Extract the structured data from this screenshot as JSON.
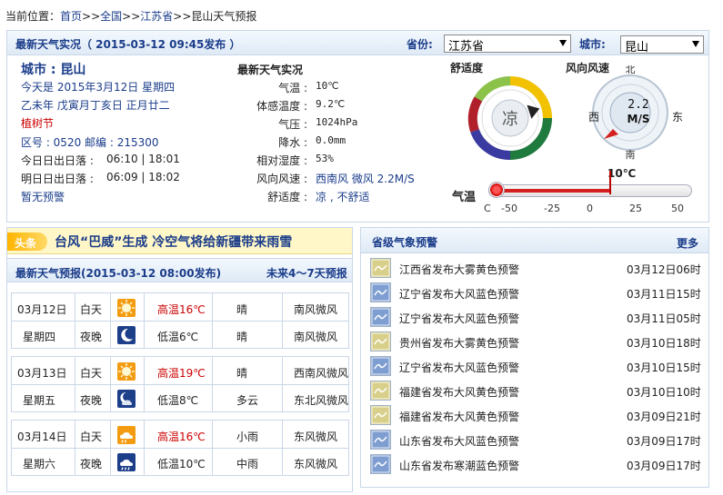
{
  "breadcrumb": {
    "prefix": "当前位置：",
    "items": [
      "首页",
      "全国",
      "江苏省",
      "昆山天气预报"
    ],
    "seps": [
      ">>",
      ">>",
      ">>"
    ]
  },
  "live": {
    "title": "最新天气实况（ 2015-03-12  09:45发布 ）",
    "province_label": "省份:",
    "province_value": "江苏省",
    "city_label": "城市:",
    "city_value": "昆山",
    "city_heading": "城市 : 昆山",
    "today": "今天是  2015年3月12日  星期四",
    "lunar": "乙未年  戊寅月丁亥日  正月廿二",
    "festival": "植树节",
    "codes": "区号 : 0520    邮编 : 215300",
    "sunrise_today_label": "今日日出日落 :",
    "sunrise_today_value": "06:10 | 18:01",
    "sunrise_tomorrow_label": "明日日出日落 :",
    "sunrise_tomorrow_value": "06:09 | 18:02",
    "no_warning": "暂无预警",
    "obs_title": "最新天气实况",
    "obs": [
      {
        "label": "气温 :",
        "value": "10℃"
      },
      {
        "label": "体感温度 :",
        "value": "9.2℃"
      },
      {
        "label": "气压 :",
        "value": "1024hPa"
      },
      {
        "label": "降水 :",
        "value": "0.0mm"
      },
      {
        "label": "相对湿度 :",
        "value": "53%"
      },
      {
        "label": "风向风速 :",
        "value": "西南风 微风 2.2M/S"
      },
      {
        "label": "舒适度 :",
        "value": "凉 , 不舒适"
      }
    ],
    "comfort_title": "舒适度",
    "comfort_value": "凉",
    "wind_title": "风向风速",
    "wind_speed": "2.2",
    "wind_unit": "M/S",
    "dir_n": "北",
    "dir_s": "南",
    "dir_w": "西",
    "dir_e": "东",
    "temp_title": "气温",
    "temp_value_label": "10℃",
    "temp_value": 10,
    "temp_scale": {
      "min": -50,
      "max": 50
    },
    "temp_ticks": [
      "C",
      "-50",
      "-25",
      "0",
      "25",
      "50"
    ]
  },
  "headline": {
    "tag": "头条",
    "text": "台风“巴威”生成 冷空气将给新疆带来雨雪"
  },
  "forecast": {
    "title": "最新天气预报(2015-03-12  08:00发布)",
    "link": "未来4～7天预报",
    "days": [
      {
        "date": "03月12日",
        "week": "星期四",
        "day": {
          "period": "白天",
          "icon": "sunny-icon",
          "temp": "高温16℃",
          "weather": "晴",
          "wind": "南风微风"
        },
        "night": {
          "period": "夜晚",
          "icon": "moon-icon",
          "temp": "低温6℃",
          "weather": "晴",
          "wind": "南风微风"
        }
      },
      {
        "date": "03月13日",
        "week": "星期五",
        "day": {
          "period": "白天",
          "icon": "sunny-icon",
          "temp": "高温19℃",
          "weather": "晴",
          "wind": "西南风微风"
        },
        "night": {
          "period": "夜晚",
          "icon": "cloudy-night-icon",
          "temp": "低温8℃",
          "weather": "多云",
          "wind": "东北风微风"
        }
      },
      {
        "date": "03月14日",
        "week": "星期六",
        "day": {
          "period": "白天",
          "icon": "light-rain-icon",
          "temp": "高温16℃",
          "weather": "小雨",
          "wind": "东风微风"
        },
        "night": {
          "period": "夜晚",
          "icon": "moderate-rain-icon",
          "temp": "低温10℃",
          "weather": "中雨",
          "wind": "东风微风"
        }
      }
    ]
  },
  "warnings": {
    "title": "省级气象预警",
    "more": "更多",
    "items": [
      {
        "icon": "fog-yellow-icon",
        "color": "yellow",
        "text": "江西省发布大雾黄色预警",
        "time": "03月12日06时"
      },
      {
        "icon": "wind-blue-icon",
        "color": "blue",
        "text": "辽宁省发布大风蓝色预警",
        "time": "03月11日15时"
      },
      {
        "icon": "wind-blue-icon",
        "color": "blue",
        "text": "辽宁省发布大风蓝色预警",
        "time": "03月11日05时"
      },
      {
        "icon": "fog-yellow-icon",
        "color": "yellow",
        "text": "贵州省发布大雾黄色预警",
        "time": "03月10日18时"
      },
      {
        "icon": "wind-blue-icon",
        "color": "blue",
        "text": "辽宁省发布大风蓝色预警",
        "time": "03月10日15时"
      },
      {
        "icon": "wind-yellow-icon",
        "color": "yellow",
        "text": "福建省发布大风黄色预警",
        "time": "03月10日10时"
      },
      {
        "icon": "wind-yellow-icon",
        "color": "yellow",
        "text": "福建省发布大风黄色预警",
        "time": "03月09日21时"
      },
      {
        "icon": "wind-blue-icon",
        "color": "blue",
        "text": "山东省发布大风蓝色预警",
        "time": "03月09日17时"
      },
      {
        "icon": "cold-blue-icon",
        "color": "blue",
        "text": "山东省发布寒潮蓝色预警",
        "time": "03月09日17时"
      }
    ]
  },
  "colors": {
    "title_blue": "#1a3c8a",
    "red": "#cc0000",
    "headline_orange": "#ff9900",
    "headline_bg": "#fff7c7",
    "border": "#c9d7e8"
  }
}
